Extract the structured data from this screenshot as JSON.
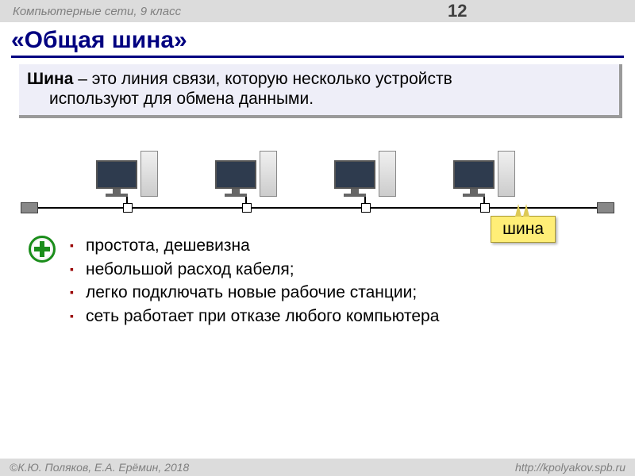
{
  "header": {
    "course": "Компьютерные сети, 9 класс",
    "page": "12"
  },
  "title": "«Общая шина»",
  "definition": {
    "term": "Шина",
    "line1": " – это линия связи, которую несколько устройств",
    "line2": "используют для обмена данными."
  },
  "callout": "шина",
  "pros": [
    "простота, дешевизна",
    "небольшой расход кабеля;",
    "легко подключать новые рабочие станции;",
    "сеть работает при отказе любого компьютера"
  ],
  "footer": {
    "copyright": "©К.Ю. Поляков, Е.А. Ерёмин, 2018",
    "url": "http://kpolyakov.spb.ru"
  }
}
